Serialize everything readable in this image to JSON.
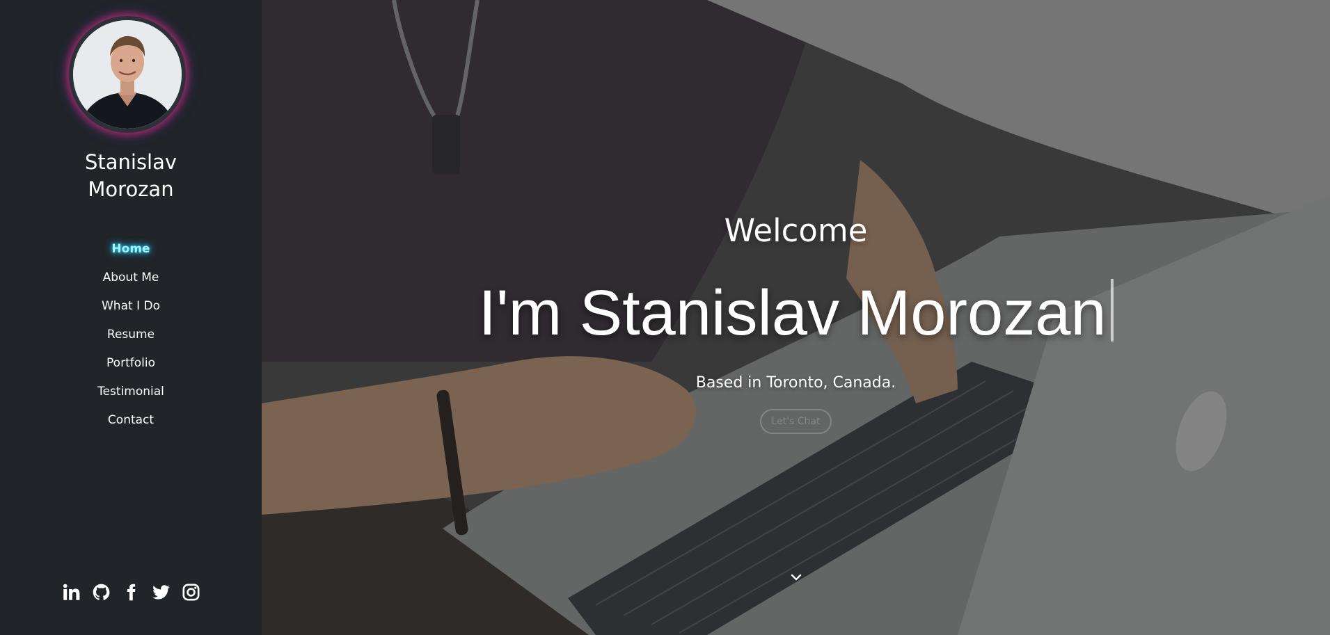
{
  "sidebar": {
    "name_line1": "Stanislav",
    "name_line2": "Morozan",
    "avatar_icon": "profile-photo",
    "nav": [
      {
        "label": "Home",
        "active": true
      },
      {
        "label": "About Me"
      },
      {
        "label": "What I Do"
      },
      {
        "label": "Resume"
      },
      {
        "label": "Portfolio"
      },
      {
        "label": "Testimonial"
      },
      {
        "label": "Contact"
      }
    ],
    "socials": [
      {
        "icon": "linkedin-icon"
      },
      {
        "icon": "github-icon"
      },
      {
        "icon": "facebook-icon"
      },
      {
        "icon": "twitter-icon"
      },
      {
        "icon": "instagram-icon"
      }
    ],
    "active_color": "#9ff6ff"
  },
  "hero": {
    "welcome": "Welcome",
    "headline": "I'm Stanislav Morozan",
    "location": "Based in Toronto, Canada.",
    "cta_label": "Let's Chat",
    "scroll_icon": "chevron-down-icon"
  }
}
